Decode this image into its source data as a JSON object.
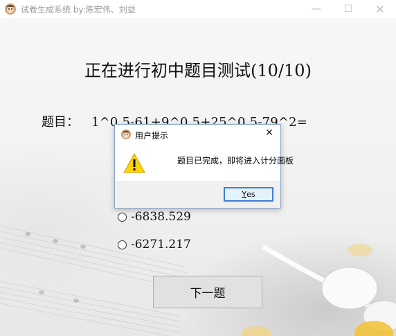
{
  "window": {
    "title": "试卷生成系统 by:陈宏伟、刘益",
    "controls": {
      "minimize": "—",
      "maximize": "☐",
      "close": "✕"
    }
  },
  "main": {
    "heading": "正在进行初中题目测试(10/10)",
    "question_label": "题目：",
    "question_expr": "1^0.5-61+9^0.5+25^0.5-79^2=",
    "options": [
      {
        "text": "-6838.529",
        "selected": false
      },
      {
        "text": "-6271.217",
        "selected": false
      }
    ],
    "next_button": "下一题"
  },
  "dialog": {
    "title": "用户提示",
    "message": "题目已完成，即将进入计分面板",
    "yes_first": "Y",
    "yes_rest": "es",
    "icon": "warning-icon",
    "accent": "#3c7fd6"
  }
}
